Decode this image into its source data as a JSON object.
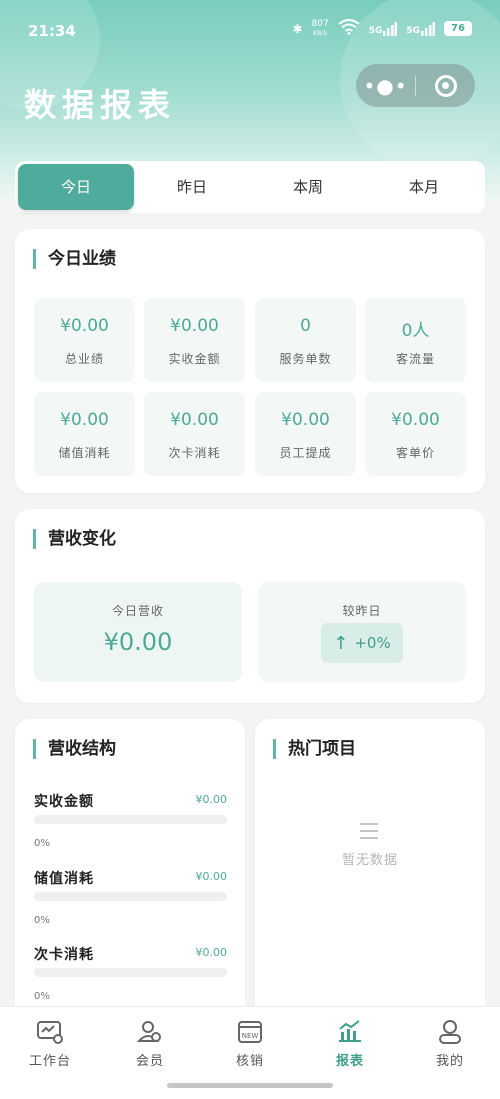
{
  "status_bar": {
    "time": "21:34",
    "net_speed": "807",
    "net_speed_unit": "KB/S",
    "signal_1": "5G",
    "signal_2": "5G",
    "battery": "76"
  },
  "header": {
    "title": "数据报表"
  },
  "tabs": [
    {
      "label": "今日",
      "active": true
    },
    {
      "label": "昨日",
      "active": false
    },
    {
      "label": "本周",
      "active": false
    },
    {
      "label": "本月",
      "active": false
    }
  ],
  "today_performance": {
    "title": "今日业绩",
    "metrics": [
      {
        "value": "¥0.00",
        "label": "总业绩"
      },
      {
        "value": "¥0.00",
        "label": "实收金额"
      },
      {
        "value": "0",
        "label": "服务单数"
      },
      {
        "value": "0人",
        "label": "客流量"
      },
      {
        "value": "¥0.00",
        "label": "储值消耗"
      },
      {
        "value": "¥0.00",
        "label": "次卡消耗"
      },
      {
        "value": "¥0.00",
        "label": "员工提成"
      },
      {
        "value": "¥0.00",
        "label": "客单价"
      }
    ]
  },
  "revenue_change": {
    "title": "营收变化",
    "today_label": "今日营收",
    "today_amount": "¥0.00",
    "compare_label": "较昨日",
    "compare_value": "+0%"
  },
  "revenue_structure": {
    "title": "营收结构",
    "items": [
      {
        "name": "实收金额",
        "amount": "¥0.00",
        "percent": "0%",
        "fill": 0
      },
      {
        "name": "储值消耗",
        "amount": "¥0.00",
        "percent": "0%",
        "fill": 0
      },
      {
        "name": "次卡消耗",
        "amount": "¥0.00",
        "percent": "0%",
        "fill": 0
      }
    ]
  },
  "hot_items": {
    "title": "热门项目",
    "empty_text": "暂无数据"
  },
  "bottom_nav": [
    {
      "label": "工作台",
      "icon": "workbench-icon",
      "active": false
    },
    {
      "label": "会员",
      "icon": "member-icon",
      "active": false
    },
    {
      "label": "核销",
      "icon": "verify-icon",
      "active": false
    },
    {
      "label": "报表",
      "icon": "report-icon",
      "active": true
    },
    {
      "label": "我的",
      "icon": "profile-icon",
      "active": false
    }
  ],
  "colors": {
    "accent": "#4fab9b",
    "value_text": "#4ea998",
    "header_gradient_top": "#78cdbf"
  }
}
